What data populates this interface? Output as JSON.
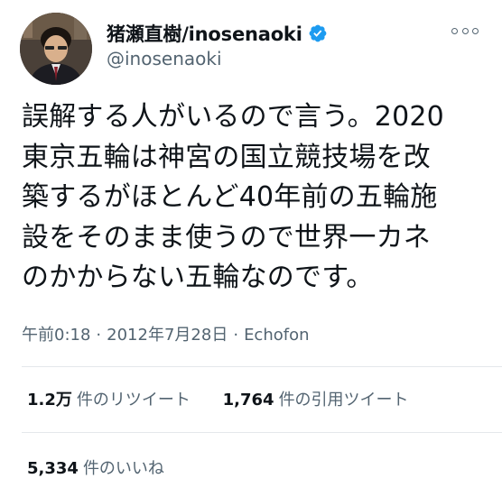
{
  "user": {
    "display_name": "猪瀬直樹/inosenaoki",
    "handle": "@inosenaoki",
    "verified_color": "#1d9bf0",
    "avatar_icon": "profile-photo"
  },
  "tweet": {
    "lines": [
      "誤解する人がいるので言う。2020",
      "東京五輪は神宮の国立競技場を改",
      "築するがほとんど40年前の五輪施",
      "設をそのまま使うので世界一カネ",
      "のかからない五輪なのです。"
    ],
    "time": "午前0:18",
    "date": "2012年7月28日",
    "separator": "·",
    "source": "Echofon"
  },
  "stats": {
    "retweets": {
      "count": "1.2万",
      "label": "件のリツイート"
    },
    "quotes": {
      "count": "1,764",
      "label": "件の引用ツイート"
    },
    "likes": {
      "count": "5,334",
      "label": "件のいいね"
    }
  }
}
